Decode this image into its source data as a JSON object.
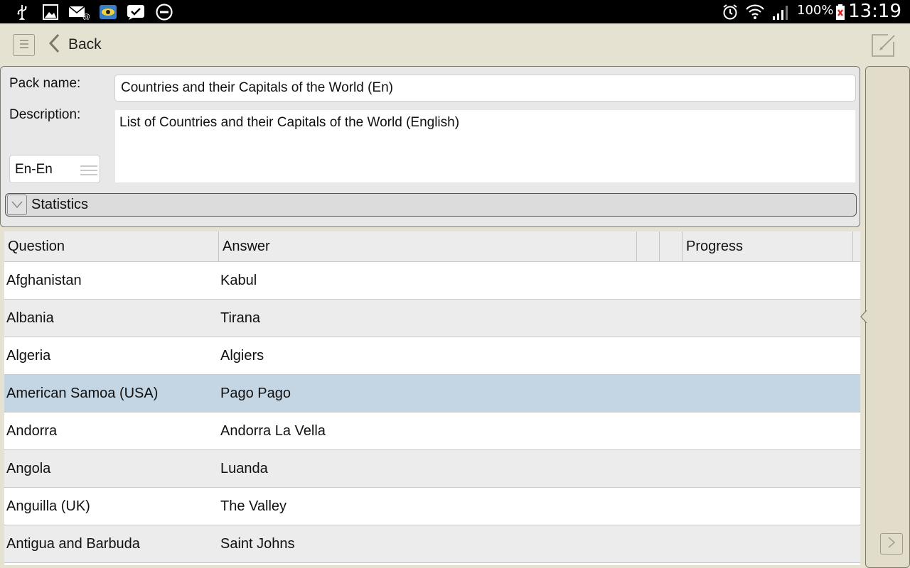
{
  "status_bar": {
    "icons_left": [
      "usb-icon",
      "image-icon",
      "mail-icon",
      "eye-app-icon",
      "check-bubble-icon",
      "do-not-disturb-icon"
    ],
    "icons_right": [
      "alarm-icon",
      "wifi-icon",
      "signal-icon",
      "battery-icon"
    ],
    "battery": "100%",
    "time": "13:19"
  },
  "toolbar": {
    "back_label": "Back"
  },
  "form": {
    "pack_name_label": "Pack name:",
    "pack_name_value": "Countries and their Capitals of the World (En)",
    "description_label": "Description:",
    "description_value": "List of Countries and their Capitals of the World (English)",
    "language_value": "En-En",
    "statistics_label": "Statistics"
  },
  "table": {
    "columns": [
      "Question",
      "Answer",
      "",
      "",
      "Progress"
    ],
    "rows": [
      {
        "question": "Afghanistan",
        "answer": "Kabul"
      },
      {
        "question": "Albania",
        "answer": "Tirana"
      },
      {
        "question": "Algeria",
        "answer": "Algiers"
      },
      {
        "question": "American Samoa (USA)",
        "answer": "Pago Pago",
        "selected": true
      },
      {
        "question": "Andorra",
        "answer": "Andorra La Vella"
      },
      {
        "question": "Angola",
        "answer": "Luanda"
      },
      {
        "question": "Anguilla (UK)",
        "answer": "The Valley"
      },
      {
        "question": "Antigua and Barbuda",
        "answer": "Saint Johns"
      }
    ]
  },
  "colors": {
    "background": "#e6e2d2",
    "selected_row": "#c4d5e3",
    "alt_row": "#ececec"
  }
}
